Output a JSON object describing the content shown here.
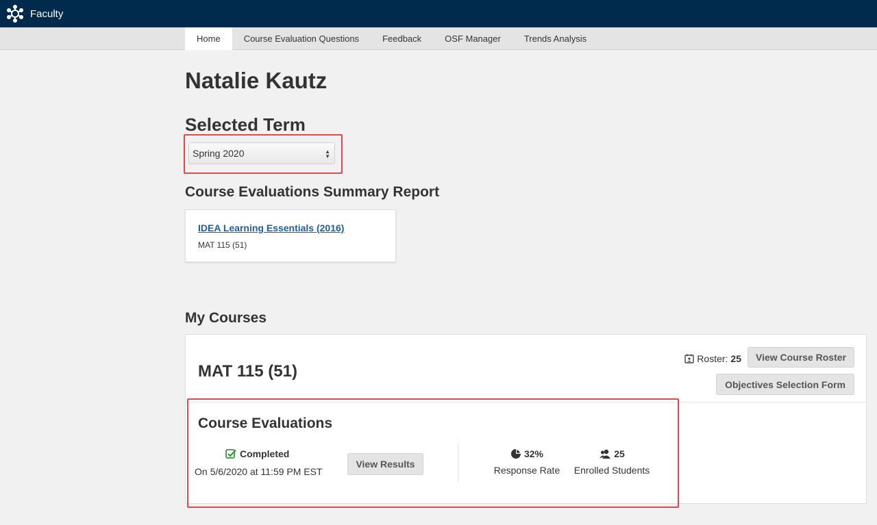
{
  "header": {
    "app_name": "Faculty",
    "logo_icon": "network-hub-icon"
  },
  "nav": {
    "tabs": [
      {
        "label": "Home",
        "active": true
      },
      {
        "label": "Course Evaluation Questions",
        "active": false
      },
      {
        "label": "Feedback",
        "active": false
      },
      {
        "label": "OSF Manager",
        "active": false
      },
      {
        "label": "Trends Analysis",
        "active": false
      }
    ]
  },
  "main": {
    "user_name": "Natalie Kautz",
    "selected_term": {
      "heading": "Selected Term",
      "value": "Spring 2020"
    },
    "summary": {
      "heading": "Course Evaluations Summary Report",
      "link_label": "IDEA Learning Essentials (2016)",
      "course_label": "MAT 115 (51)"
    },
    "my_courses": {
      "heading": "My Courses",
      "course": {
        "title": "MAT 115 (51)",
        "roster_label": "Roster:",
        "roster_count": "25",
        "view_roster_label": "View Course Roster",
        "objectives_label": "Objectives Selection Form",
        "evaluations": {
          "heading": "Course Evaluations",
          "status": "Completed",
          "date": "On 5/6/2020 at 11:59 PM EST",
          "view_results_label": "View Results",
          "response_rate_value": "32%",
          "response_rate_label": "Response Rate",
          "enrolled_value": "25",
          "enrolled_label": "Enrolled Students"
        }
      }
    }
  },
  "colors": {
    "header_bg": "#002b4d",
    "highlight": "#e0484d",
    "link": "#1a5fa8",
    "success": "#3a9a3a"
  }
}
